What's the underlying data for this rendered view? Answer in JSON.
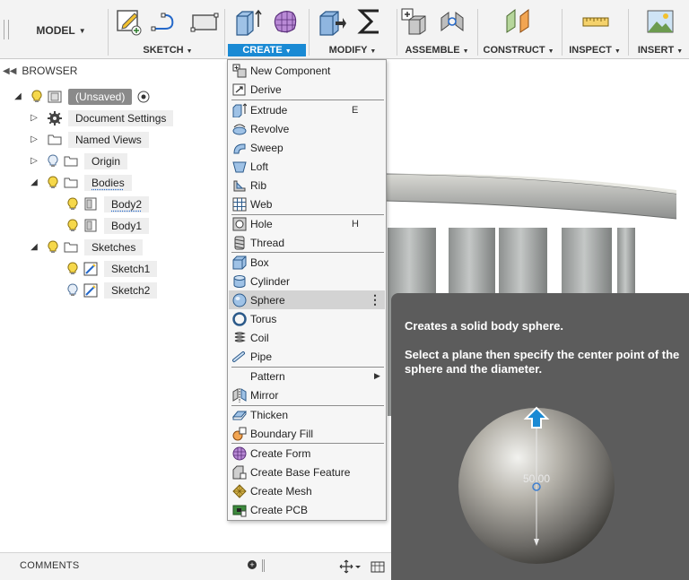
{
  "toolbar": {
    "model_label": "MODEL",
    "groups": [
      {
        "label": "SKETCH"
      },
      {
        "label": "CREATE"
      },
      {
        "label": "MODIFY"
      },
      {
        "label": "ASSEMBLE"
      },
      {
        "label": "CONSTRUCT"
      },
      {
        "label": "INSPECT"
      },
      {
        "label": "INSERT"
      }
    ],
    "accent_color": "#1a8ad4"
  },
  "browser": {
    "title": "BROWSER",
    "root_label": "(Unsaved)",
    "nodes": [
      {
        "label": "Document Settings"
      },
      {
        "label": "Named Views"
      },
      {
        "label": "Origin"
      },
      {
        "label": "Bodies"
      },
      {
        "label": "Body2"
      },
      {
        "label": "Body1"
      },
      {
        "label": "Sketches"
      },
      {
        "label": "Sketch1"
      },
      {
        "label": "Sketch2"
      }
    ]
  },
  "create_menu": {
    "items": [
      {
        "label": "New Component",
        "icon": "new-component-icon"
      },
      {
        "label": "Derive",
        "icon": "derive-icon"
      },
      {
        "label": "Extrude",
        "icon": "extrude-icon",
        "shortcut": "E"
      },
      {
        "label": "Revolve",
        "icon": "revolve-icon"
      },
      {
        "label": "Sweep",
        "icon": "sweep-icon"
      },
      {
        "label": "Loft",
        "icon": "loft-icon"
      },
      {
        "label": "Rib",
        "icon": "rib-icon"
      },
      {
        "label": "Web",
        "icon": "web-icon"
      },
      {
        "label": "Hole",
        "icon": "hole-icon",
        "shortcut": "H"
      },
      {
        "label": "Thread",
        "icon": "thread-icon"
      },
      {
        "label": "Box",
        "icon": "box-icon"
      },
      {
        "label": "Cylinder",
        "icon": "cylinder-icon"
      },
      {
        "label": "Sphere",
        "icon": "sphere-icon"
      },
      {
        "label": "Torus",
        "icon": "torus-icon"
      },
      {
        "label": "Coil",
        "icon": "coil-icon"
      },
      {
        "label": "Pipe",
        "icon": "pipe-icon"
      },
      {
        "label": "Pattern"
      },
      {
        "label": "Mirror",
        "icon": "mirror-icon"
      },
      {
        "label": "Thicken",
        "icon": "thicken-icon"
      },
      {
        "label": "Boundary Fill",
        "icon": "boundary-fill-icon"
      },
      {
        "label": "Create Form",
        "icon": "create-form-icon"
      },
      {
        "label": "Create Base Feature",
        "icon": "create-base-feature-icon"
      },
      {
        "label": "Create Mesh",
        "icon": "create-mesh-icon"
      },
      {
        "label": "Create PCB",
        "icon": "create-pcb-icon"
      }
    ],
    "highlighted": "Sphere"
  },
  "tooltip": {
    "title": "Creates a solid body sphere.",
    "description": "Select a plane then specify the center point of the sphere and the diameter.",
    "dimension_value": "50.00"
  },
  "bottom_bar": {
    "comments_label": "COMMENTS"
  }
}
